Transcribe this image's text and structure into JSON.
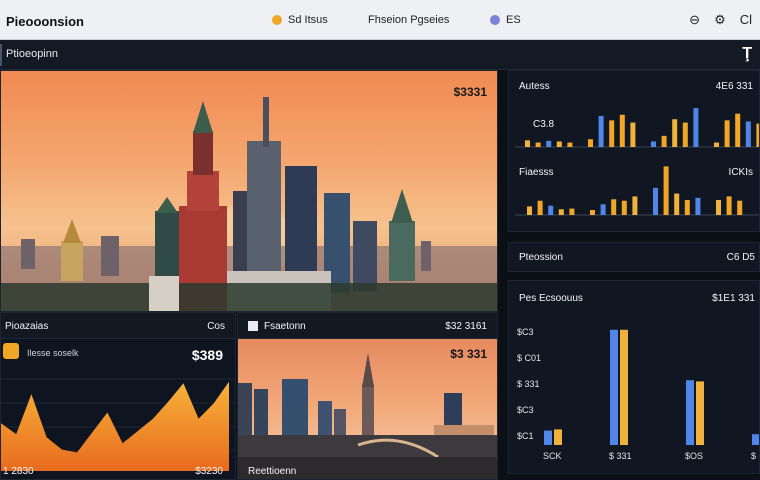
{
  "app": {
    "title": "Pieooonsion",
    "nav": [
      {
        "label": "Sd Itsus",
        "color": "#f2a626"
      },
      {
        "label": "Fhseion Pgseies",
        "color": ""
      },
      {
        "label": "ES",
        "color": "#7b83d6"
      }
    ],
    "icons": [
      "gauge-icon",
      "settings-icon",
      "grid-icon"
    ],
    "icon_labels": [
      "⊖",
      "⚙",
      "Cl"
    ]
  },
  "section": {
    "label": "Ptioeopinn",
    "icon": "Ţ"
  },
  "hero": {
    "value": "$3331"
  },
  "left_stat": {
    "label": "Pioazaias",
    "right": "Cos",
    "sub": "Ilesse soselk",
    "value": "$389",
    "bottom_left": "1 2830",
    "bottom_right": "$3230"
  },
  "mid_stat": {
    "label": "Fsaetonn",
    "value": "$3 331",
    "right": "$32 3161",
    "bottom": "Reettioenn"
  },
  "right_top": {
    "label": "Autess",
    "value": "4E6 331",
    "sub": "C3.8",
    "row2_label": "Fiaesss",
    "row2_value": "ICKIs"
  },
  "right_mid": {
    "label": "Pteossion",
    "value": "C6 D5"
  },
  "right_bottom": {
    "label": "Pes Ecsoouus",
    "value": "$1E1 331",
    "ylabels": [
      "$C3",
      "$ C01",
      "$ 331",
      "$C3",
      "$C1"
    ],
    "xlabels": [
      "SCK",
      "$ 331",
      "$OS",
      "$ 5"
    ]
  },
  "colors": {
    "orange": "#f2a626",
    "blue": "#4f86e8",
    "amber": "#f0b23a",
    "dark": "#111722"
  },
  "chart_data": [
    {
      "type": "bar",
      "title": "Autess",
      "series": [
        {
          "values": [
            0.6,
            0.4,
            0.55,
            0.5,
            0.4,
            0.7,
            2.8,
            2.4,
            2.9,
            2.2,
            0.5,
            1.0,
            2.5,
            2.2,
            3.5,
            0.4,
            2.4,
            3.0,
            2.3,
            2.1
          ]
        }
      ]
    },
    {
      "type": "bar",
      "title": "Fiaesss",
      "series": [
        {
          "values": [
            1.2,
            2.0,
            1.3,
            0.8,
            0.9,
            0.7,
            1.5,
            2.2,
            2.0,
            2.6,
            3.8,
            6.8,
            3.0,
            2.1,
            2.4,
            2.1,
            2.6,
            2.0
          ]
        }
      ]
    },
    {
      "type": "bar",
      "title": "Pes Ecsoouus",
      "categories": [
        "SCK",
        "$ 331",
        "$OS",
        "$ 5"
      ],
      "series": [
        {
          "values": [
            1.2,
            9.6,
            5.4,
            0.9
          ]
        },
        {
          "values": [
            1.3,
            9.6,
            5.3,
            3.6
          ]
        }
      ]
    },
    {
      "type": "area",
      "title": "Pioazaias",
      "values": [
        3.1,
        2.4,
        5.0,
        2.2,
        1.4,
        1.2,
        2.5,
        3.8,
        1.8,
        2.6,
        3.4,
        4.5,
        5.7,
        3.4,
        4.4,
        5.8
      ]
    }
  ]
}
